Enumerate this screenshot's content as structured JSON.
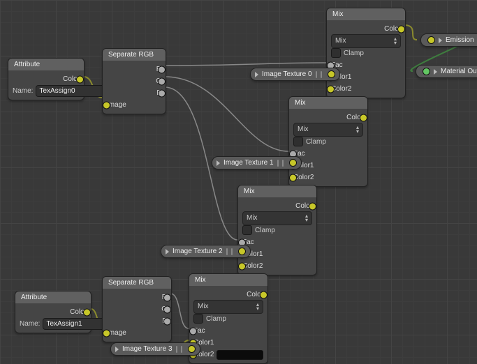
{
  "nodes": {
    "attr0": {
      "title": "Attribute",
      "out_color": "Color",
      "name_label": "Name:",
      "name_value": "TexAssign0"
    },
    "attr1": {
      "title": "Attribute",
      "out_color": "Color",
      "name_label": "Name:",
      "name_value": "TexAssign1"
    },
    "sep0": {
      "title": "Separate RGB",
      "r": "R",
      "g": "G",
      "b": "B",
      "image": "Image"
    },
    "sep1": {
      "title": "Separate RGB",
      "r": "R",
      "g": "G",
      "b": "B",
      "image": "Image"
    },
    "mix0": {
      "title": "Mix",
      "out": "Color",
      "mode": "Mix",
      "clamp": "Clamp",
      "fac": "Fac",
      "c1": "Color1",
      "c2": "Color2"
    },
    "mix1": {
      "title": "Mix",
      "out": "Color",
      "mode": "Mix",
      "clamp": "Clamp",
      "fac": "Fac",
      "c1": "Color1",
      "c2": "Color2"
    },
    "mix2": {
      "title": "Mix",
      "out": "Color",
      "mode": "Mix",
      "clamp": "Clamp",
      "fac": "Fac",
      "c1": "Color1",
      "c2": "Color2"
    },
    "mix3": {
      "title": "Mix",
      "out": "Color",
      "mode": "Mix",
      "clamp": "Clamp",
      "fac": "Fac",
      "c1": "Color1",
      "c2": "Color2",
      "swatch": "#0b0b0b"
    },
    "imgtex": [
      "Image Texture 0",
      "Image Texture 1",
      "Image Texture 2",
      "Image Texture 3"
    ],
    "emission": "Emission",
    "matout": "Material Output"
  }
}
